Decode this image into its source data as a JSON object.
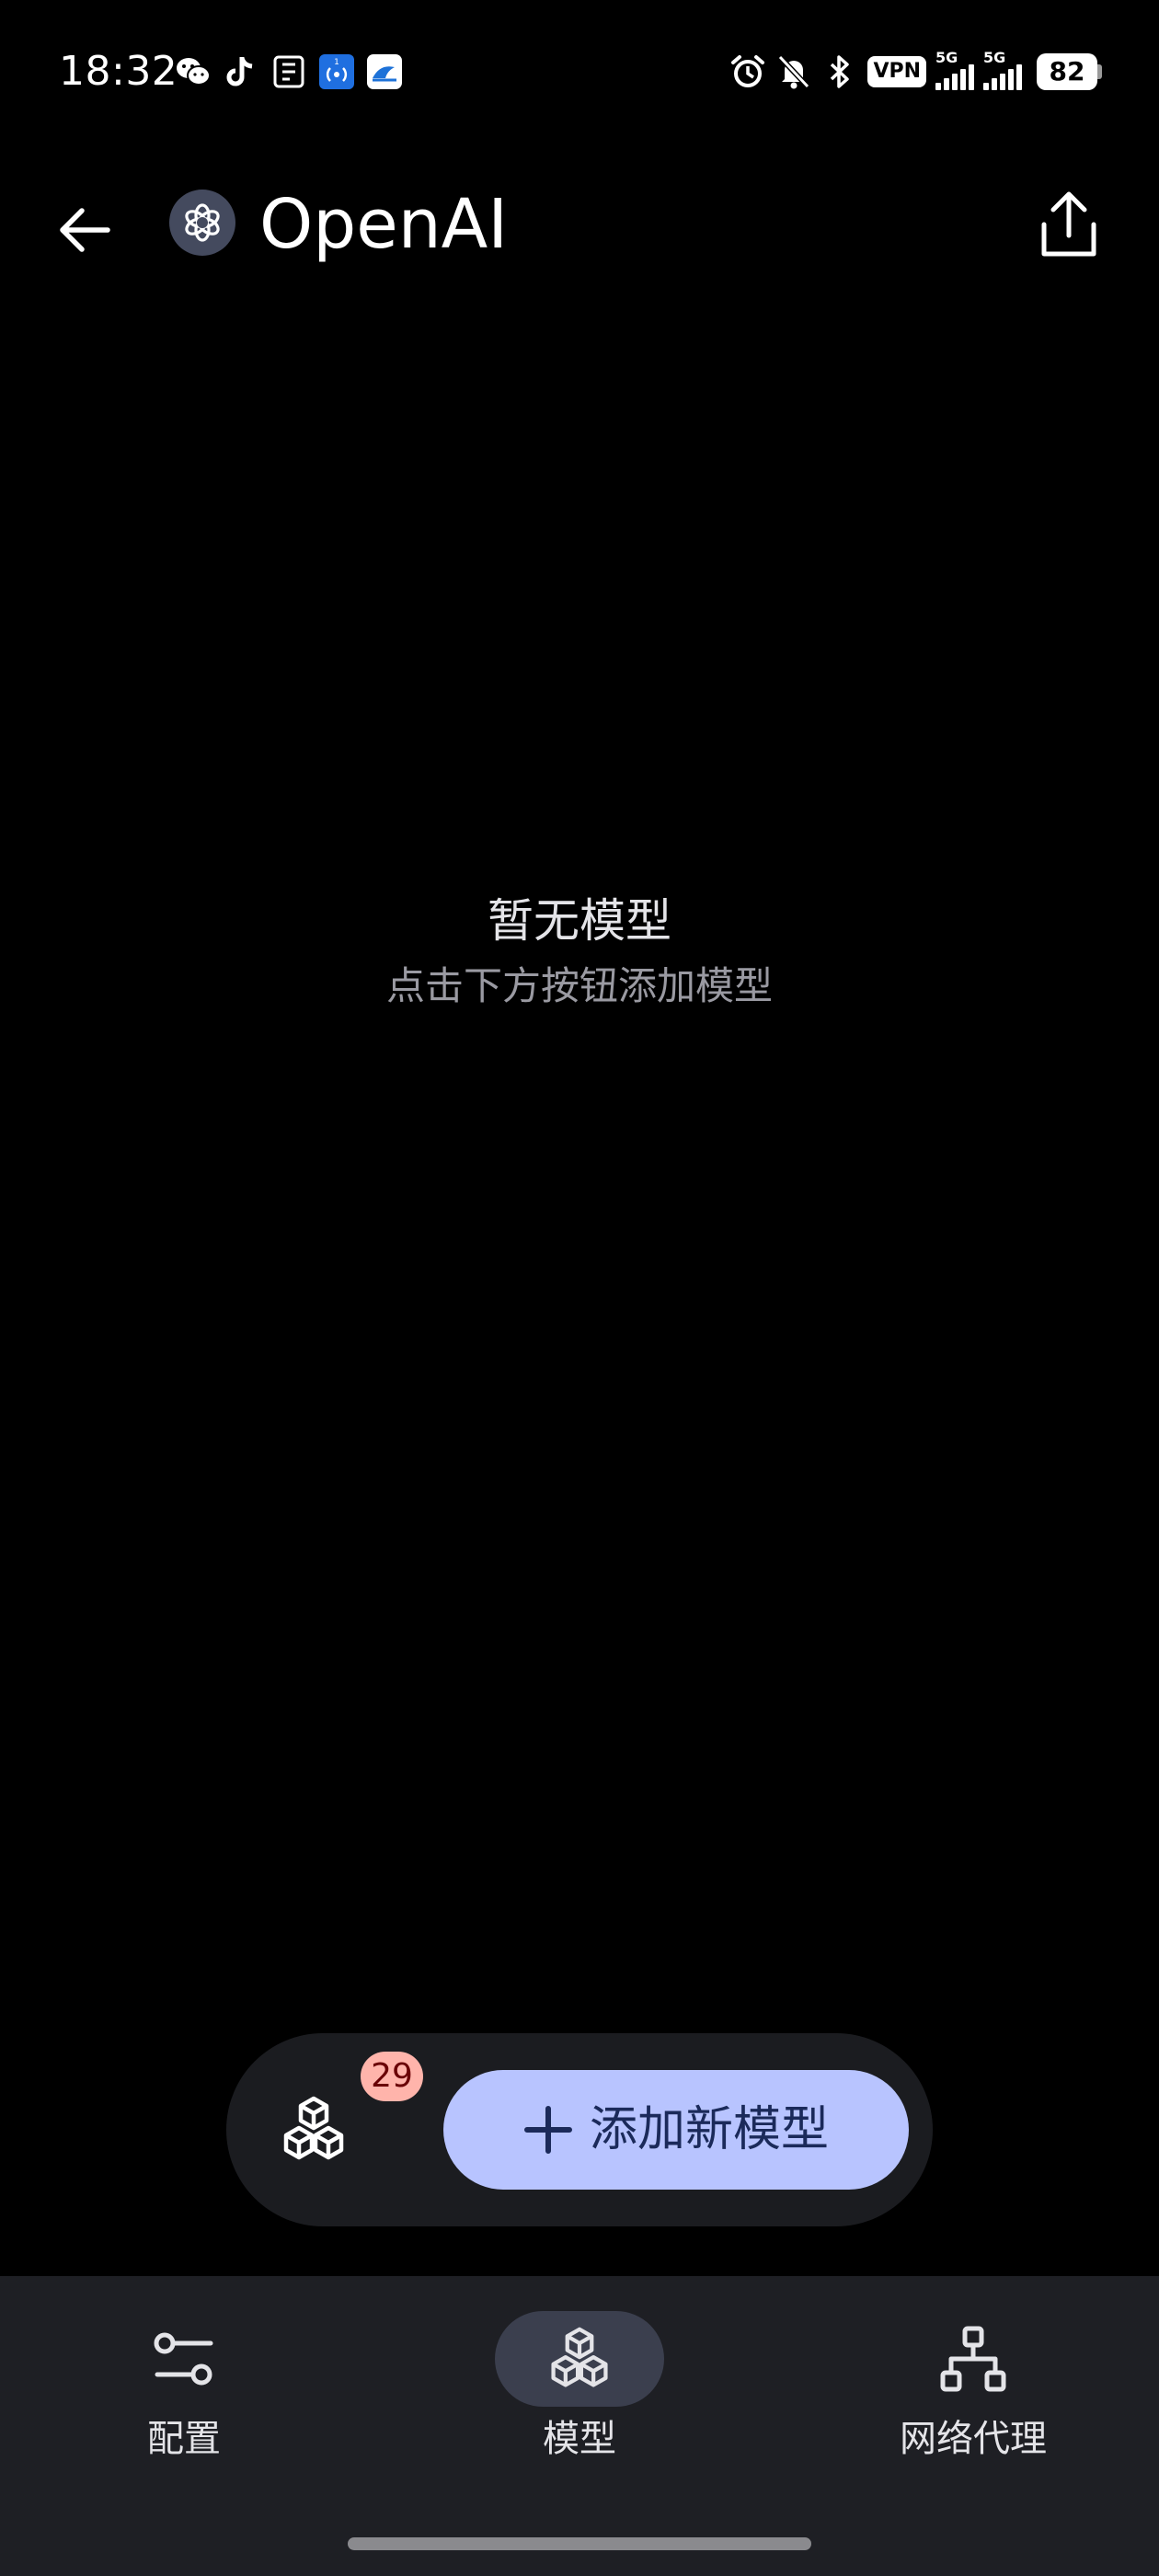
{
  "status_bar": {
    "time": "18:32",
    "left_icons": [
      "wechat-icon",
      "tiktok-icon",
      "notepad-icon",
      "nfc-app-icon",
      "wave-app-icon"
    ],
    "right_icons": [
      "alarm-icon",
      "mute-bell-icon",
      "bluetooth-icon"
    ],
    "vpn_label": "VPN",
    "signal_1_label": "5G",
    "signal_2_label": "5G",
    "battery": "82"
  },
  "app_bar": {
    "title": "OpenAI",
    "back_icon": "arrow-left-icon",
    "share_icon": "share-icon"
  },
  "empty_state": {
    "title": "暂无模型",
    "subtitle": "点击下方按钮添加模型"
  },
  "action_bar": {
    "models_count": "29",
    "add_button_label": "添加新模型"
  },
  "bottom_nav": {
    "items": [
      {
        "label": "配置",
        "icon": "sliders-icon",
        "active": false
      },
      {
        "label": "模型",
        "icon": "cubes-icon",
        "active": true
      },
      {
        "label": "网络代理",
        "icon": "network-icon",
        "active": false
      }
    ]
  },
  "colors": {
    "background": "#000000",
    "accent_button": "#b8c4ff",
    "badge": "#ffb4ab",
    "nav_background": "#1e1f24",
    "nav_active_pill": "#3b3f4e"
  }
}
